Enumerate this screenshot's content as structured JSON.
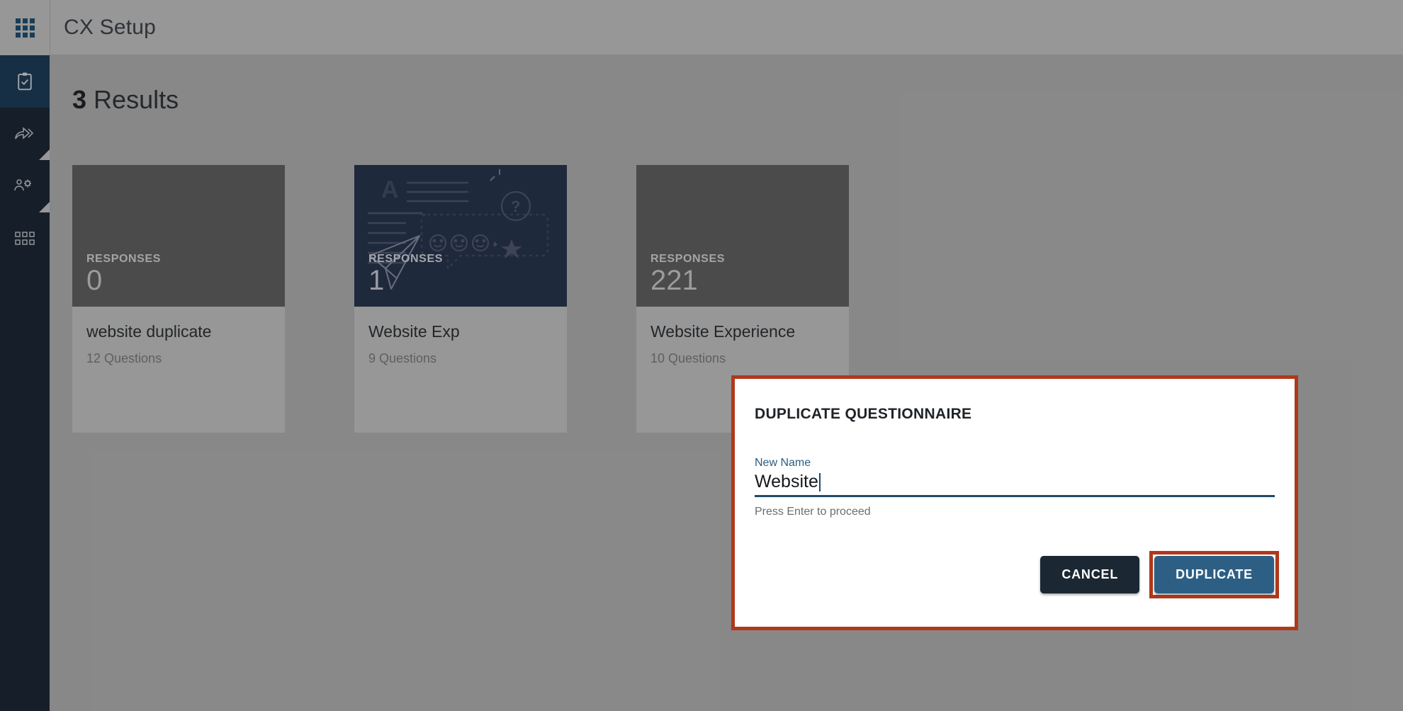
{
  "app": {
    "title": "CX Setup",
    "logo_icon": "apps-grid-icon"
  },
  "colors": {
    "sidebar_bg": "#1b2733",
    "sidebar_active_bg": "#1b3a54",
    "topbar_bg": "#b9b9b9",
    "content_bg": "#a7a7a7",
    "card_thumb_bg": "#5c5c5c",
    "card_illustration_bg": "#27334a",
    "dialog_border": "#b0381a",
    "primary_button": "#2d5f85",
    "secondary_button": "#1b2733",
    "field_underline": "#1f4a6b",
    "field_label": "#2a5d82"
  },
  "sidebar": {
    "items": [
      {
        "name": "questionnaires",
        "icon": "clipboard-check-icon",
        "active": true,
        "has_submenu": false
      },
      {
        "name": "distribution",
        "icon": "share-forward-icon",
        "active": false,
        "has_submenu": true
      },
      {
        "name": "user-settings",
        "icon": "users-gear-icon",
        "active": false,
        "has_submenu": true
      },
      {
        "name": "apps",
        "icon": "grid-squares-icon",
        "active": false,
        "has_submenu": false
      }
    ]
  },
  "main": {
    "results_count": "3",
    "results_label": "Results",
    "cards": [
      {
        "responses_label": "RESPONSES",
        "responses_count": "0",
        "title": "website duplicate",
        "questions": "12 Questions",
        "illustrated": false
      },
      {
        "responses_label": "RESPONSES",
        "responses_count": "1",
        "title": "Website Exp",
        "questions": "9 Questions",
        "illustrated": true
      },
      {
        "responses_label": "RESPONSES",
        "responses_count": "221",
        "title": "Website Experience",
        "questions": "10 Questions",
        "illustrated": false
      }
    ]
  },
  "dialog": {
    "title": "DUPLICATE QUESTIONNAIRE",
    "field_label": "New Name",
    "field_value": "Website",
    "field_placeholder": "New Name",
    "help_text": "Press Enter to proceed",
    "cancel_label": "CANCEL",
    "confirm_label": "DUPLICATE"
  }
}
